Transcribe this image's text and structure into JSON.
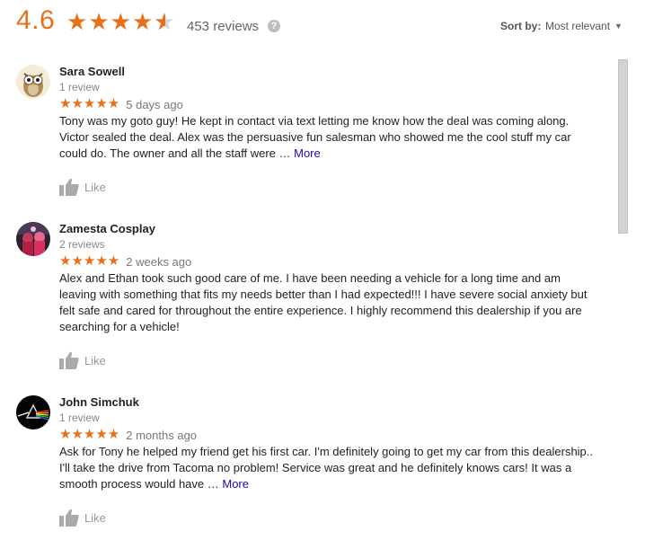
{
  "header": {
    "rating": "4.6",
    "stars_fraction": 0.92,
    "review_count": "453 reviews",
    "help_icon": "question-icon",
    "sort_label": "Sort by:",
    "sort_value": "Most relevant",
    "sort_icon": "caret-down-icon"
  },
  "reviews": [
    {
      "author": "Sara Sowell",
      "count": "1 review",
      "stars": "★★★★★",
      "date": "5 days ago",
      "text": "Tony was my goto guy! He kept in contact via text letting me know how the deal was coming along. Victor sealed the deal. Alex was the persuasive fun salesman who showed me the cool stuff my car could do. The owner and all the staff were … ",
      "more": "More",
      "like": "Like"
    },
    {
      "author": "Zamesta Cosplay",
      "count": "2 reviews",
      "stars": "★★★★★",
      "date": "2 weeks ago",
      "text": "Alex and Ethan took such good care of me. I have been needing a vehicle for a long time and am leaving with something that fits my needs better than I had expected!!! I have severe social anxiety but felt safe and cared for throughout the entire experience. I highly recommend this dealership if you are searching for a vehicle!",
      "more": "",
      "like": "Like"
    },
    {
      "author": "John Simchuk",
      "count": "1 review",
      "stars": "★★★★★",
      "date": "2 months ago",
      "text": "Ask for Tony he helped my friend get his first car. I'm definitely going to get my car from this dealership.. I'll take the drive from Tacoma no problem! Service was great and he definitely knows cars! It was a smooth process would have … ",
      "more": "More",
      "like": "Like"
    }
  ],
  "colors": {
    "star": "#e7711b",
    "link": "#1a0dab",
    "muted": "#999999"
  }
}
